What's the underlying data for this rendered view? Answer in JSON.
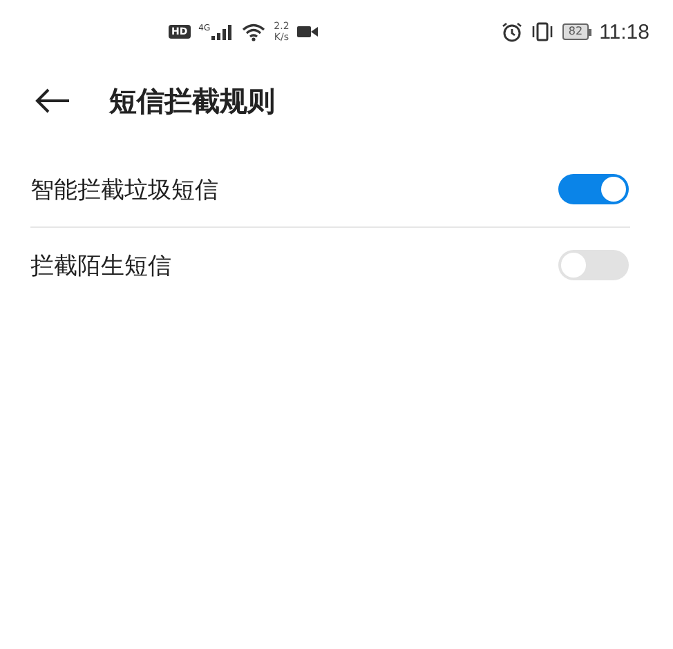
{
  "status_bar": {
    "hd_badge": "HD",
    "network": "4G",
    "speed_value": "2.2",
    "speed_unit": "K/s",
    "battery": "82",
    "time": "11:18"
  },
  "header": {
    "title": "短信拦截规则"
  },
  "settings": [
    {
      "label": "智能拦截垃圾短信",
      "on": true
    },
    {
      "label": "拦截陌生短信",
      "on": false
    }
  ]
}
